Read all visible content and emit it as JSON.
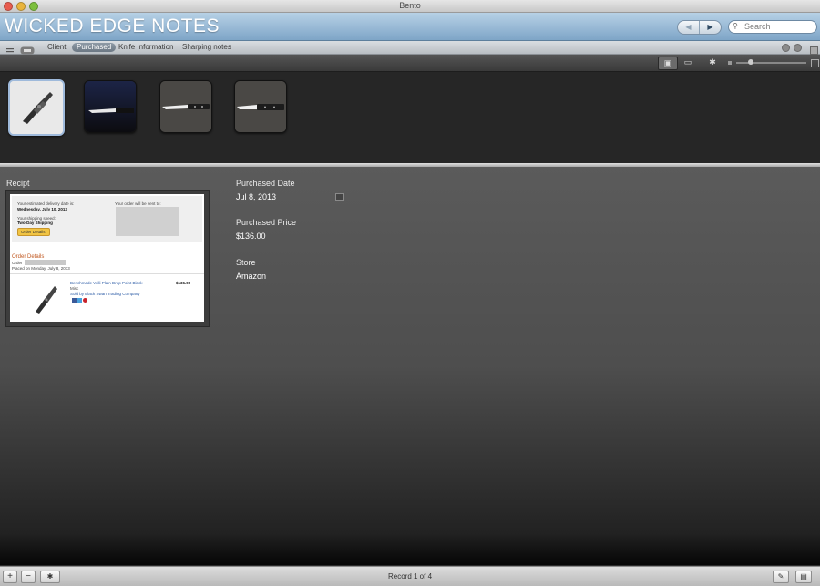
{
  "window": {
    "title": "Bento"
  },
  "header": {
    "app_title": "WICKED EDGE NOTES",
    "nav_back": "◀",
    "nav_forward": "▶",
    "search_placeholder": "Search"
  },
  "tabs": [
    {
      "label": "Client",
      "active": false
    },
    {
      "label": "Purchased",
      "active": true
    },
    {
      "label": "Knife Information",
      "active": false
    },
    {
      "label": "Sharping notes",
      "active": false
    }
  ],
  "gallery": {
    "thumb_count": 4,
    "selected_index": 0
  },
  "fields": {
    "receipt": {
      "label": "Recipt"
    },
    "purchased_date": {
      "label": "Purchased Date",
      "value": "Jul 8, 2013"
    },
    "purchased_price": {
      "label": "Purchased Price",
      "value": "$136.00"
    },
    "store": {
      "label": "Store",
      "value": "Amazon"
    }
  },
  "receipt_image": {
    "delivery_label": "Your estimated delivery date is:",
    "delivery_date": "Wednesday, July 10, 2013",
    "speed_label": "Your shipping speed:",
    "speed_value": "Two-Day Shipping",
    "ship_to_label": "Your order will be sent to:",
    "order_button": "Order Details",
    "order_details_heading": "Order Details",
    "order_label": "Order",
    "placed_on": "Placed on Monday, July 8, 2013",
    "item_name": "Benchmade Volli Plain Drop Point Black",
    "item_qty": "Misc",
    "sold_by": "Sold by Black Swan Trading Company",
    "item_price": "$136.00"
  },
  "status": {
    "record_text": "Record 1 of 4",
    "add": "+",
    "remove": "−",
    "action": "✱"
  },
  "colors": {
    "header_blue": "#8fb1cf",
    "selected_border": "#9fbadb",
    "background": "#4e4e4e"
  }
}
